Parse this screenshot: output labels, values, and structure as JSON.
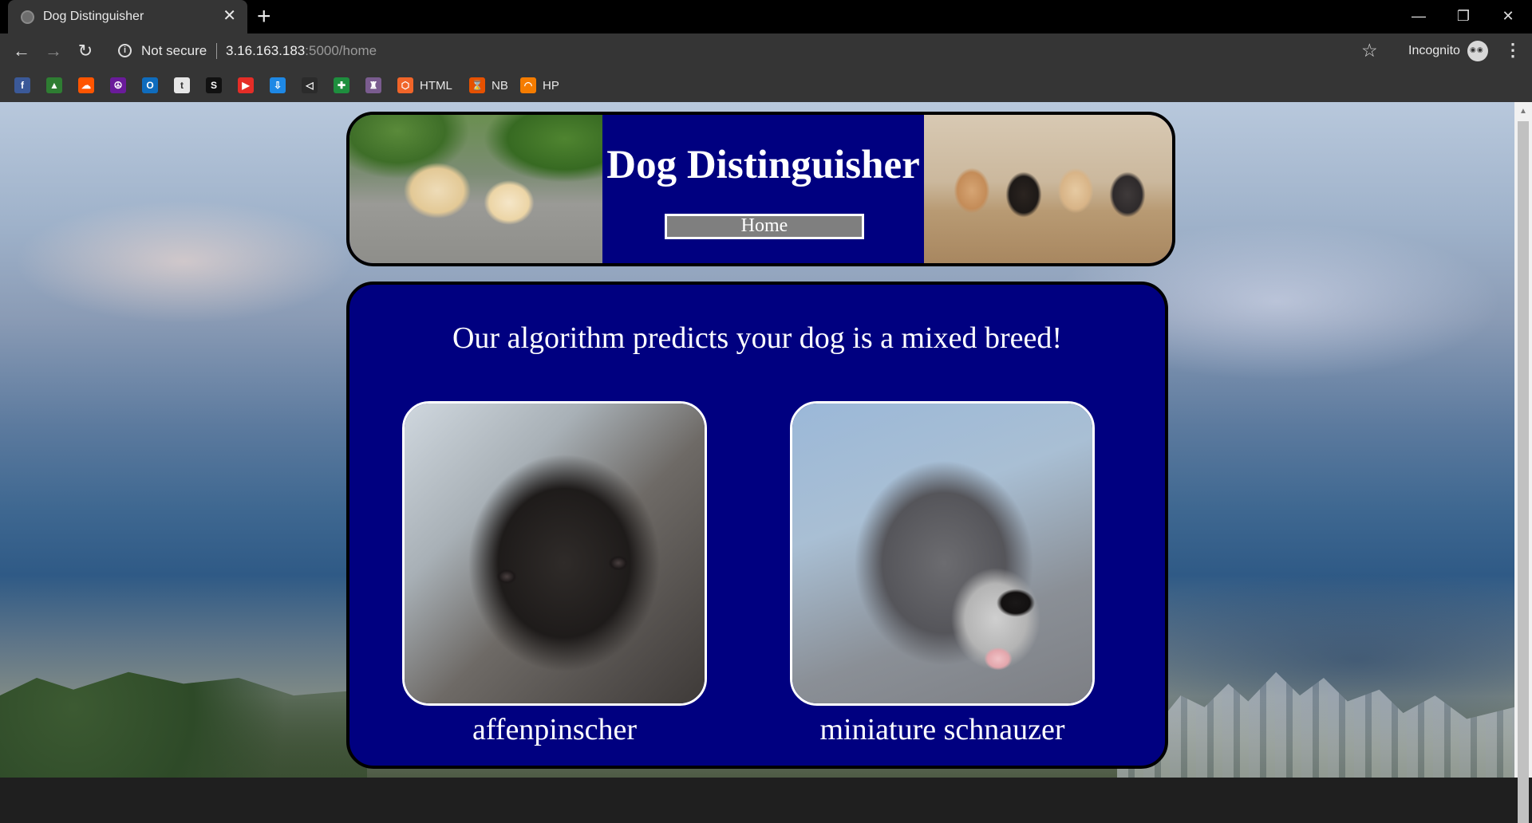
{
  "browser": {
    "tab_title": "Dog Distinguisher",
    "tab_close": "✕",
    "new_tab": "+",
    "window_controls": {
      "minimize": "—",
      "restore": "❐",
      "close": "✕"
    },
    "nav": {
      "back": "←",
      "forward": "→",
      "reload": "↻"
    },
    "security_label": "Not secure",
    "url_host": "3.16.163.183",
    "url_path": ":5000/home",
    "bookmark_star": "☆",
    "profile_label": "Incognito",
    "menu": "⋮",
    "bookmarks": [
      {
        "icon": "facebook-icon",
        "glyph": "f",
        "color": "#3b5998",
        "label": ""
      },
      {
        "icon": "tree-icon",
        "glyph": "▲",
        "color": "#2e7d32",
        "label": ""
      },
      {
        "icon": "soundcloud-icon",
        "glyph": "☁",
        "color": "#ff5500",
        "label": ""
      },
      {
        "icon": "peace-icon",
        "glyph": "☮",
        "color": "#6a1b9a",
        "label": ""
      },
      {
        "icon": "outlook-icon",
        "glyph": "O",
        "color": "#0f6cbd",
        "label": ""
      },
      {
        "icon": "document-icon",
        "glyph": "t",
        "color": "#e6e6e6",
        "label": ""
      },
      {
        "icon": "s-icon",
        "glyph": "S",
        "color": "#111111",
        "label": ""
      },
      {
        "icon": "youtube-icon",
        "glyph": "▶",
        "color": "#e52d27",
        "label": ""
      },
      {
        "icon": "cloud-download-icon",
        "glyph": "⇩",
        "color": "#1e88e5",
        "label": ""
      },
      {
        "icon": "vscode-icon",
        "glyph": "◁",
        "color": "#2b2b2b",
        "label": ""
      },
      {
        "icon": "cross-icon",
        "glyph": "✚",
        "color": "#1e8e3e",
        "label": ""
      },
      {
        "icon": "crest-icon",
        "glyph": "♜",
        "color": "#7a5c8f",
        "label": ""
      },
      {
        "icon": "html-icon",
        "glyph": "⬡",
        "color": "#f16529",
        "label": "HTML"
      },
      {
        "icon": "hourglass-icon",
        "glyph": "⌛",
        "color": "#e65100",
        "label": "NB"
      },
      {
        "icon": "hp-icon",
        "glyph": "◠",
        "color": "#f57c00",
        "label": "HP"
      }
    ]
  },
  "page": {
    "site_title": "Dog Distinguisher",
    "nav_home": "Home",
    "result_message": "Our algorithm predicts your dog is a mixed breed!",
    "breeds": [
      {
        "name": "affenpinscher"
      },
      {
        "name": "miniature schnauzer"
      }
    ]
  }
}
